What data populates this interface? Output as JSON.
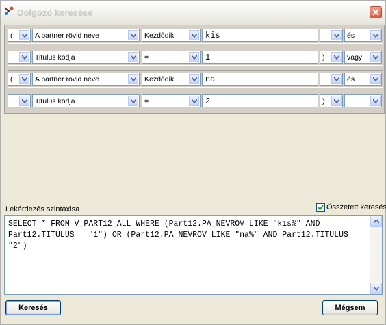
{
  "window": {
    "title": "Dolgozó keresése"
  },
  "filters": [
    {
      "open_paren": "(",
      "field": "A partner rövid neve",
      "operator": "Kezdődik",
      "value": "kis",
      "close_paren": "",
      "logic": "és"
    },
    {
      "open_paren": "",
      "field": "Titulus kódja",
      "operator": "=",
      "value": "1",
      "close_paren": ")",
      "logic": "vagy"
    },
    {
      "open_paren": "(",
      "field": "A partner rövid neve",
      "operator": "Kezdődik",
      "value": "na",
      "close_paren": "",
      "logic": "és"
    },
    {
      "open_paren": "",
      "field": "Titulus kódja",
      "operator": "=",
      "value": "2",
      "close_paren": ")",
      "logic": ""
    }
  ],
  "syntax": {
    "label": "Lekérdezés szintaxisa",
    "composite_label": "Összetett keresés",
    "composite_checked": true,
    "query": "SELECT * FROM V_PART12_ALL WHERE (Part12.PA_NEVROV LIKE \"kis%\" AND Part12.TITULUS = \"1\") OR (Part12.PA_NEVROV LIKE \"na%\" AND Part12.TITULUS = \"2\")"
  },
  "buttons": {
    "search": "Keresés",
    "cancel": "Mégsem"
  }
}
